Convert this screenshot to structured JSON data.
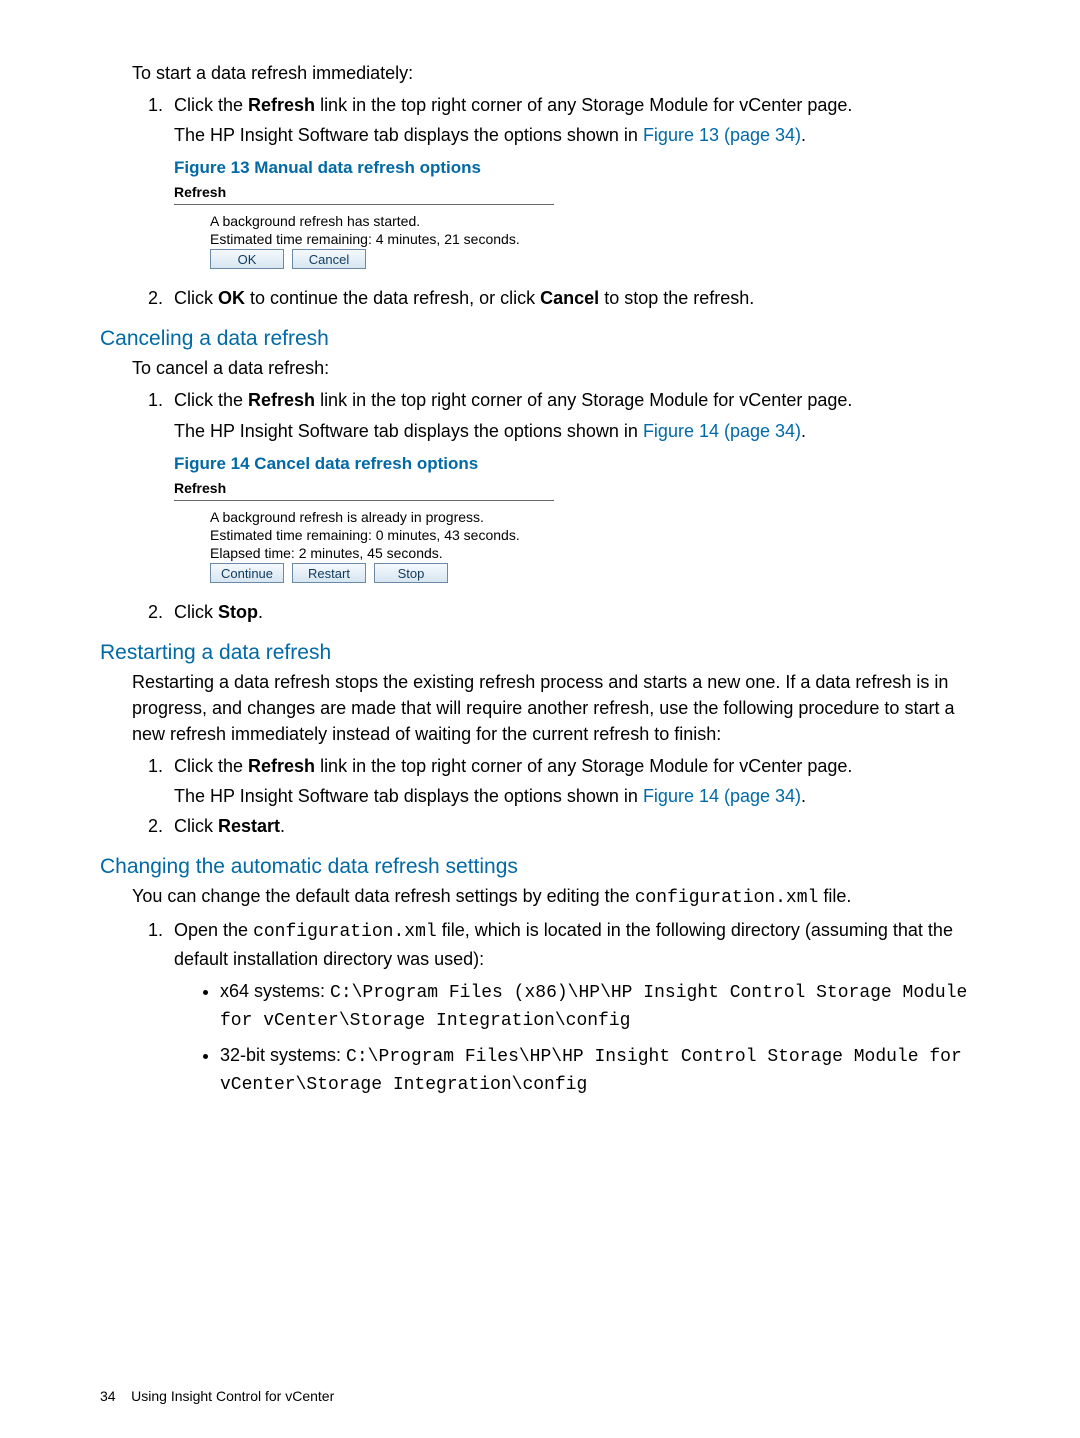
{
  "intro": {
    "lead": "To start a data refresh immediately:",
    "step1_a": "Click the ",
    "step1_b_bold": "Refresh",
    "step1_c": " link in the top right corner of any Storage Module for vCenter page.",
    "step1_p2_a": "The HP Insight Software tab displays the options shown in ",
    "step1_p2_link": "Figure 13 (page 34)",
    "step1_p2_b": "."
  },
  "fig13": {
    "caption": "Figure 13 Manual data refresh options",
    "title": "Refresh",
    "line1": "A background refresh has started.",
    "line2": "Estimated time remaining: 4 minutes, 21 seconds.",
    "btn_ok": "OK",
    "btn_cancel": "Cancel"
  },
  "intro_step2": {
    "a": "Click ",
    "ok": "OK",
    "b": " to continue the data refresh, or click ",
    "cancel": "Cancel",
    "c": " to stop the refresh."
  },
  "cancel_sec": {
    "heading": "Canceling a data refresh",
    "lead": "To cancel a data refresh:",
    "step1_a": "Click the ",
    "step1_b_bold": "Refresh",
    "step1_c": " link in the top right corner of any Storage Module for vCenter page.",
    "step1_p2_a": "The HP Insight Software tab displays the options shown in ",
    "step1_p2_link": "Figure 14 (page 34)",
    "step1_p2_b": "."
  },
  "fig14": {
    "caption": "Figure 14 Cancel data refresh options",
    "title": "Refresh",
    "line1": "A background refresh is already in progress.",
    "line2": "Estimated time remaining: 0 minutes, 43 seconds.",
    "line3": "Elapsed time: 2 minutes, 45 seconds.",
    "btn_continue": "Continue",
    "btn_restart": "Restart",
    "btn_stop": "Stop"
  },
  "cancel_step2": {
    "a": "Click ",
    "b": "Stop",
    "c": "."
  },
  "restart_sec": {
    "heading": "Restarting a data refresh",
    "para": "Restarting a data refresh stops the existing refresh process and starts a new one. If a data refresh is in progress, and changes are made that will require another refresh, use the following procedure to start a new refresh immediately instead of waiting for the current refresh to finish:",
    "step1_a": "Click the ",
    "step1_b_bold": "Refresh",
    "step1_c": " link in the top right corner of any Storage Module for vCenter page.",
    "step1_p2_a": "The HP Insight Software tab displays the options shown in ",
    "step1_p2_link": "Figure 14 (page 34)",
    "step1_p2_b": ".",
    "step2_a": "Click ",
    "step2_b": "Restart",
    "step2_c": "."
  },
  "change_sec": {
    "heading": "Changing the automatic data refresh settings",
    "lead_a": "You can change the default data refresh settings by editing the ",
    "lead_code": "configuration.xml",
    "lead_b": " file.",
    "step1_a": "Open the ",
    "step1_code": "configuration.xml",
    "step1_b": " file, which is located in the following directory (assuming that the default installation directory was used):",
    "bullets": {
      "x64_a": "x64 systems: ",
      "x64_code": "C:\\Program Files (x86)\\HP\\HP Insight Control Storage Module for vCenter\\Storage Integration\\config",
      "x32_a": "32-bit systems: ",
      "x32_code": "C:\\Program Files\\HP\\HP Insight Control Storage Module for vCenter\\Storage Integration\\config"
    }
  },
  "footer": {
    "page": "34",
    "title": "Using Insight Control for vCenter"
  }
}
